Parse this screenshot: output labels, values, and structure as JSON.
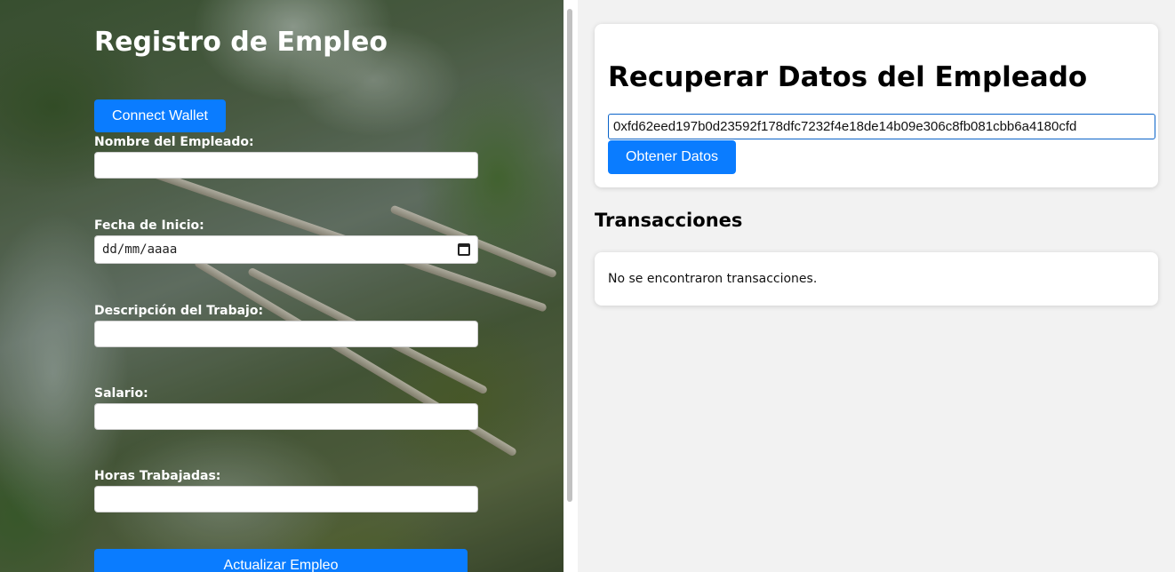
{
  "form": {
    "title": "Registro de Empleo",
    "connect_wallet_label": "Connect Wallet",
    "fields": {
      "name_label": "Nombre del Empleado:",
      "name_value": "",
      "start_date_label": "Fecha de Inicio:",
      "start_date_placeholder": "dd/mm/aaaa",
      "description_label": "Descripción del Trabajo:",
      "description_value": "",
      "salary_label": "Salario:",
      "salary_value": "",
      "hours_label": "Horas Trabajadas:",
      "hours_value": ""
    },
    "submit_label": "Actualizar Empleo"
  },
  "retrieve": {
    "title": "Recuperar Datos del Empleado",
    "hash_value": "0xfd62eed197b0d23592f178dfc7232f4e18de14b09e306c8fb081cbb6a4180cfd",
    "get_button_label": "Obtener Datos"
  },
  "transactions": {
    "title": "Transacciones",
    "empty_message": "No se encontraron transacciones."
  },
  "colors": {
    "button_blue": "#0a7cff",
    "page_background": "#f2f2f2"
  }
}
